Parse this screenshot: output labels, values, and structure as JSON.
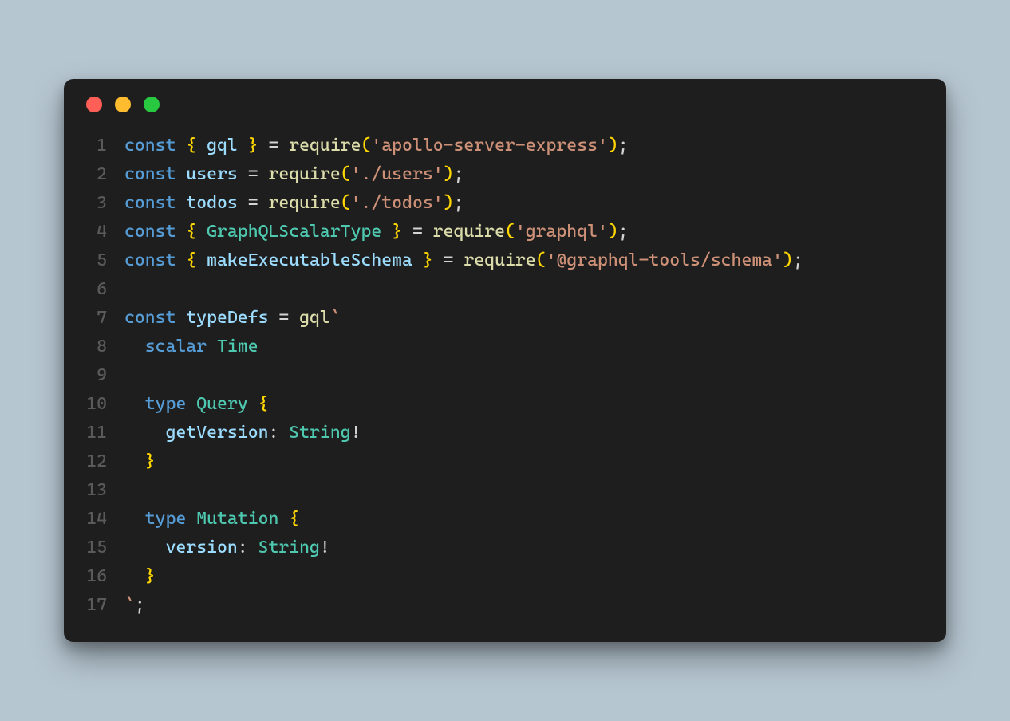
{
  "traffic_lights": {
    "red": "#ff5f57",
    "yellow": "#febc2e",
    "green": "#28c840"
  },
  "code_lines": [
    {
      "num": "1",
      "tokens": [
        {
          "cls": "tok-keyword",
          "text": "const"
        },
        {
          "cls": "tok-punct",
          "text": " "
        },
        {
          "cls": "tok-brace",
          "text": "{"
        },
        {
          "cls": "tok-punct",
          "text": " "
        },
        {
          "cls": "tok-var",
          "text": "gql"
        },
        {
          "cls": "tok-punct",
          "text": " "
        },
        {
          "cls": "tok-brace",
          "text": "}"
        },
        {
          "cls": "tok-punct",
          "text": " = "
        },
        {
          "cls": "tok-fn",
          "text": "require"
        },
        {
          "cls": "tok-brace",
          "text": "("
        },
        {
          "cls": "tok-string",
          "text": "'apollo-server-express'"
        },
        {
          "cls": "tok-brace",
          "text": ")"
        },
        {
          "cls": "tok-punct",
          "text": ";"
        }
      ]
    },
    {
      "num": "2",
      "tokens": [
        {
          "cls": "tok-keyword",
          "text": "const"
        },
        {
          "cls": "tok-punct",
          "text": " "
        },
        {
          "cls": "tok-var",
          "text": "users"
        },
        {
          "cls": "tok-punct",
          "text": " = "
        },
        {
          "cls": "tok-fn",
          "text": "require"
        },
        {
          "cls": "tok-brace",
          "text": "("
        },
        {
          "cls": "tok-string",
          "text": "'./users'"
        },
        {
          "cls": "tok-brace",
          "text": ")"
        },
        {
          "cls": "tok-punct",
          "text": ";"
        }
      ]
    },
    {
      "num": "3",
      "tokens": [
        {
          "cls": "tok-keyword",
          "text": "const"
        },
        {
          "cls": "tok-punct",
          "text": " "
        },
        {
          "cls": "tok-var",
          "text": "todos"
        },
        {
          "cls": "tok-punct",
          "text": " = "
        },
        {
          "cls": "tok-fn",
          "text": "require"
        },
        {
          "cls": "tok-brace",
          "text": "("
        },
        {
          "cls": "tok-string",
          "text": "'./todos'"
        },
        {
          "cls": "tok-brace",
          "text": ")"
        },
        {
          "cls": "tok-punct",
          "text": ";"
        }
      ]
    },
    {
      "num": "4",
      "tokens": [
        {
          "cls": "tok-keyword",
          "text": "const"
        },
        {
          "cls": "tok-punct",
          "text": " "
        },
        {
          "cls": "tok-brace",
          "text": "{"
        },
        {
          "cls": "tok-punct",
          "text": " "
        },
        {
          "cls": "tok-ident",
          "text": "GraphQLScalarType"
        },
        {
          "cls": "tok-punct",
          "text": " "
        },
        {
          "cls": "tok-brace",
          "text": "}"
        },
        {
          "cls": "tok-punct",
          "text": " = "
        },
        {
          "cls": "tok-fn",
          "text": "require"
        },
        {
          "cls": "tok-brace",
          "text": "("
        },
        {
          "cls": "tok-string",
          "text": "'graphql'"
        },
        {
          "cls": "tok-brace",
          "text": ")"
        },
        {
          "cls": "tok-punct",
          "text": ";"
        }
      ]
    },
    {
      "num": "5",
      "tokens": [
        {
          "cls": "tok-keyword",
          "text": "const"
        },
        {
          "cls": "tok-punct",
          "text": " "
        },
        {
          "cls": "tok-brace",
          "text": "{"
        },
        {
          "cls": "tok-punct",
          "text": " "
        },
        {
          "cls": "tok-var",
          "text": "makeExecutableSchema"
        },
        {
          "cls": "tok-punct",
          "text": " "
        },
        {
          "cls": "tok-brace",
          "text": "}"
        },
        {
          "cls": "tok-punct",
          "text": " = "
        },
        {
          "cls": "tok-fn",
          "text": "require"
        },
        {
          "cls": "tok-brace",
          "text": "("
        },
        {
          "cls": "tok-string",
          "text": "'@graphql-tools/schema'"
        },
        {
          "cls": "tok-brace",
          "text": ")"
        },
        {
          "cls": "tok-punct",
          "text": ";"
        }
      ]
    },
    {
      "num": "6",
      "tokens": []
    },
    {
      "num": "7",
      "tokens": [
        {
          "cls": "tok-keyword",
          "text": "const"
        },
        {
          "cls": "tok-punct",
          "text": " "
        },
        {
          "cls": "tok-var",
          "text": "typeDefs"
        },
        {
          "cls": "tok-punct",
          "text": " = "
        },
        {
          "cls": "tok-fn",
          "text": "gql"
        },
        {
          "cls": "tok-string",
          "text": "`"
        }
      ]
    },
    {
      "num": "8",
      "tokens": [
        {
          "cls": "tok-punct",
          "text": "  "
        },
        {
          "cls": "tok-keyword",
          "text": "scalar"
        },
        {
          "cls": "tok-punct",
          "text": " "
        },
        {
          "cls": "tok-ident",
          "text": "Time"
        }
      ]
    },
    {
      "num": "9",
      "tokens": []
    },
    {
      "num": "10",
      "tokens": [
        {
          "cls": "tok-punct",
          "text": "  "
        },
        {
          "cls": "tok-keyword",
          "text": "type"
        },
        {
          "cls": "tok-punct",
          "text": " "
        },
        {
          "cls": "tok-ident",
          "text": "Query"
        },
        {
          "cls": "tok-punct",
          "text": " "
        },
        {
          "cls": "tok-brace",
          "text": "{"
        }
      ]
    },
    {
      "num": "11",
      "tokens": [
        {
          "cls": "tok-punct",
          "text": "    "
        },
        {
          "cls": "tok-var",
          "text": "getVersion"
        },
        {
          "cls": "tok-punct",
          "text": ": "
        },
        {
          "cls": "tok-ident",
          "text": "String"
        },
        {
          "cls": "tok-punct",
          "text": "!"
        }
      ]
    },
    {
      "num": "12",
      "tokens": [
        {
          "cls": "tok-punct",
          "text": "  "
        },
        {
          "cls": "tok-brace",
          "text": "}"
        }
      ]
    },
    {
      "num": "13",
      "tokens": []
    },
    {
      "num": "14",
      "tokens": [
        {
          "cls": "tok-punct",
          "text": "  "
        },
        {
          "cls": "tok-keyword",
          "text": "type"
        },
        {
          "cls": "tok-punct",
          "text": " "
        },
        {
          "cls": "tok-ident",
          "text": "Mutation"
        },
        {
          "cls": "tok-punct",
          "text": " "
        },
        {
          "cls": "tok-brace",
          "text": "{"
        }
      ]
    },
    {
      "num": "15",
      "tokens": [
        {
          "cls": "tok-punct",
          "text": "    "
        },
        {
          "cls": "tok-var",
          "text": "version"
        },
        {
          "cls": "tok-punct",
          "text": ": "
        },
        {
          "cls": "tok-ident",
          "text": "String"
        },
        {
          "cls": "tok-punct",
          "text": "!"
        }
      ]
    },
    {
      "num": "16",
      "tokens": [
        {
          "cls": "tok-punct",
          "text": "  "
        },
        {
          "cls": "tok-brace",
          "text": "}"
        }
      ]
    },
    {
      "num": "17",
      "tokens": [
        {
          "cls": "tok-string",
          "text": "`"
        },
        {
          "cls": "tok-punct",
          "text": ";"
        }
      ]
    }
  ]
}
